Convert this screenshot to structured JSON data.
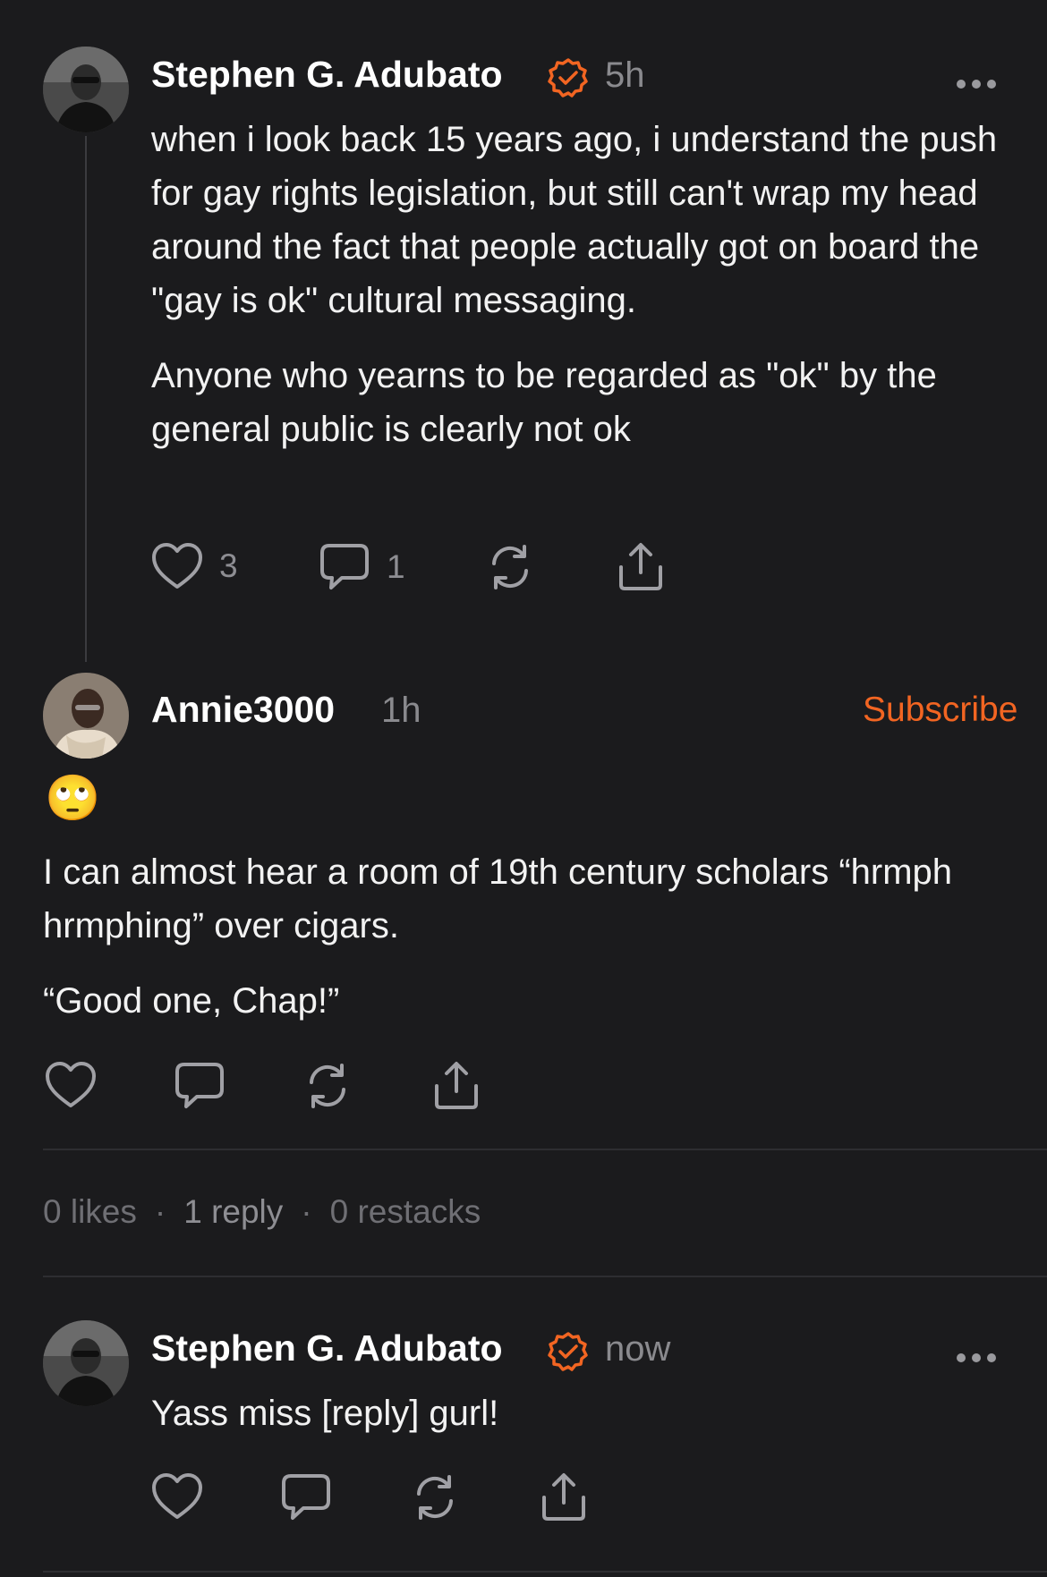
{
  "colors": {
    "background": "#1b1b1d",
    "accent": "#f26522",
    "muted": "#8a8a8e"
  },
  "post1": {
    "author": "Stephen G. Adubato",
    "verified_icon": "verified-badge-icon",
    "time": "5h",
    "paragraph1": "when i look back 15 years ago, i understand the push for gay rights legislation, but still can't wrap my head around the fact that people actually got on board the \"gay is ok\" cultural messaging.",
    "paragraph2": "Anyone who yearns to be regarded as \"ok\" by the general public is clearly not ok",
    "likes": "3",
    "comments": "1"
  },
  "post2": {
    "author": "Annie3000",
    "time": "1h",
    "subscribe_label": "Subscribe",
    "emoji": "🙄",
    "paragraph1": "I can almost hear a room of 19th century scholars “hrmph hrmphing” over cigars.",
    "paragraph2": "“Good one, Chap!”",
    "stats": {
      "likes": "0 likes",
      "replies": "1 reply",
      "restacks": "0 restacks",
      "separator": "·"
    }
  },
  "post3": {
    "author": "Stephen G. Adubato",
    "time": "now",
    "text": "Yass miss [reply] gurl!"
  },
  "icons": [
    "heart-icon",
    "comment-icon",
    "restack-icon",
    "share-icon",
    "more-icon"
  ]
}
